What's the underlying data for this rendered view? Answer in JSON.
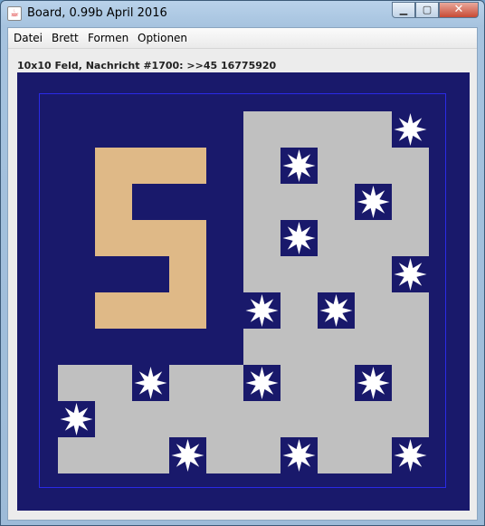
{
  "window": {
    "title": "Board, 0.99b April 2016",
    "controls": {
      "minimize": "▁",
      "maximize": "▢",
      "close": "✕"
    }
  },
  "menu": [
    "Datei",
    "Brett",
    "Formen",
    "Optionen"
  ],
  "status": "10x10 Feld, Nachricht #1700: >>45 16775920",
  "board": {
    "columns": 11,
    "rows": 11,
    "colors": {
      "background": "#19196b",
      "gray": "#c0c0c0",
      "tan": "#dfb987",
      "star": "#ffffff"
    },
    "grid": [
      "...........",
      "......GGGGS",
      "..TTT.GSGGG",
      "..T...GGGSG",
      "..TTT.GSGGG",
      "....T.GGGGS",
      "..TTT.SGSGG",
      "......GGGGG",
      ".GGSGGSGGSG",
      ".SGGGGGGGGG",
      ".GGGSGGSGGS"
    ]
  }
}
